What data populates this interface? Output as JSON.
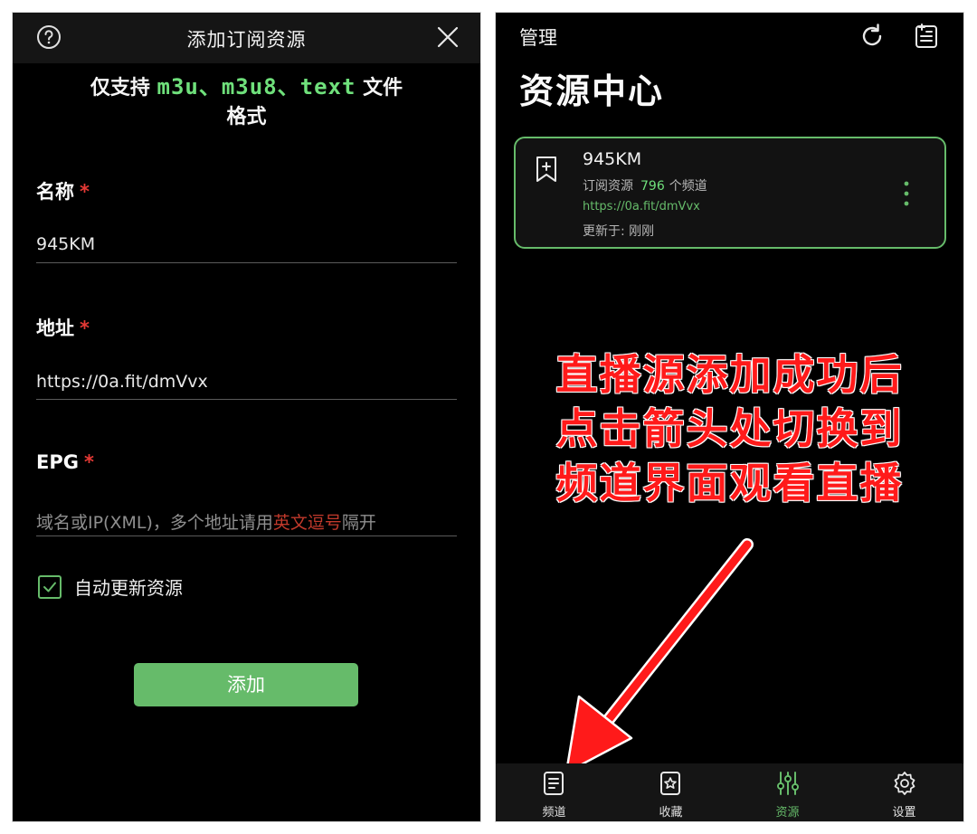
{
  "left": {
    "header": {
      "title": "添加订阅资源"
    },
    "support": {
      "prefix": "仅支持",
      "formats": "m3u、m3u8、text",
      "suffix": "文件",
      "line2": "格式"
    },
    "fields": {
      "name": {
        "label": "名称",
        "required": "*",
        "value": "945KM"
      },
      "address": {
        "label": "地址",
        "required": "*",
        "value": "https://0a.fit/dmVvx"
      },
      "epg": {
        "label": "EPG",
        "required": "*",
        "placeholder_a": "域名或IP(XML)，多个地址请用",
        "placeholder_red": "英文逗号",
        "placeholder_b": "隔开"
      }
    },
    "auto_update": {
      "label": "自动更新资源",
      "checked": true
    },
    "add_button": "添加"
  },
  "right": {
    "header": {
      "title": "管理"
    },
    "page_title": "资源中心",
    "card": {
      "name": "945KM",
      "type": "订阅资源",
      "count": "796",
      "count_unit": "个频道",
      "url": "https://0a.fit/dmVvx",
      "updated": "更新于: 刚刚"
    },
    "overlay": [
      "直播源添加成功后",
      "点击箭头处切换到",
      "频道界面观看直播"
    ],
    "nav": [
      {
        "label": "频道",
        "icon": "document-list-icon",
        "active": false
      },
      {
        "label": "收藏",
        "icon": "star-frame-icon",
        "active": false
      },
      {
        "label": "资源",
        "icon": "sliders-icon",
        "active": true
      },
      {
        "label": "设置",
        "icon": "gear-icon",
        "active": false
      }
    ]
  },
  "colors": {
    "accent": "#66bb6a",
    "required": "#e53935",
    "overlay_text": "#ff1a1a",
    "background": "#000000"
  }
}
